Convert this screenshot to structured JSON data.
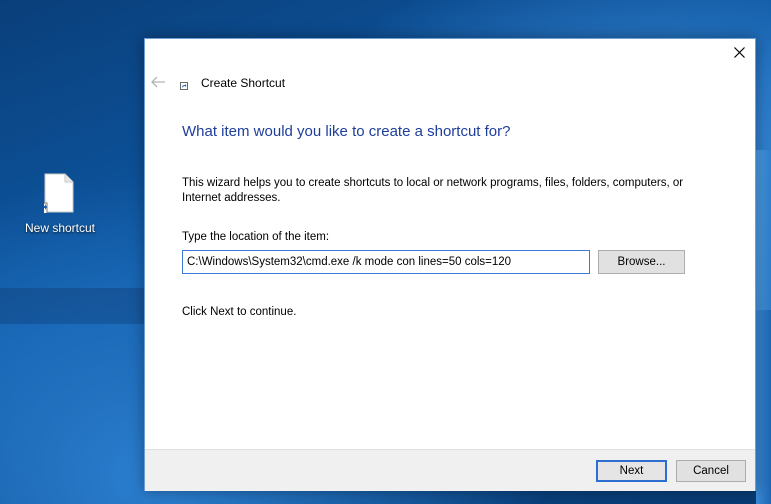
{
  "desktop": {
    "icons": [
      {
        "label": "New shortcut",
        "icon": "shortcut-file-icon"
      }
    ]
  },
  "dialog": {
    "title": "Create Shortcut",
    "title_icon": "shortcut-icon",
    "back_icon": "back-arrow-icon",
    "close_icon": "close-icon",
    "heading": "What item would you like to create a shortcut for?",
    "description": "This wizard helps you to create shortcuts to local or network programs, files, folders, computers, or Internet addresses.",
    "location_label": "Type the location of the item:",
    "location_value": "C:\\Windows\\System32\\cmd.exe /k mode con lines=50 cols=120",
    "browse_label": "Browse...",
    "continue_text": "Click Next to continue.",
    "next_label": "Next",
    "cancel_label": "Cancel"
  },
  "colors": {
    "heading": "#1e3e9b",
    "desktop": "#0b4f93",
    "focus_border": "#2d6fd1"
  }
}
